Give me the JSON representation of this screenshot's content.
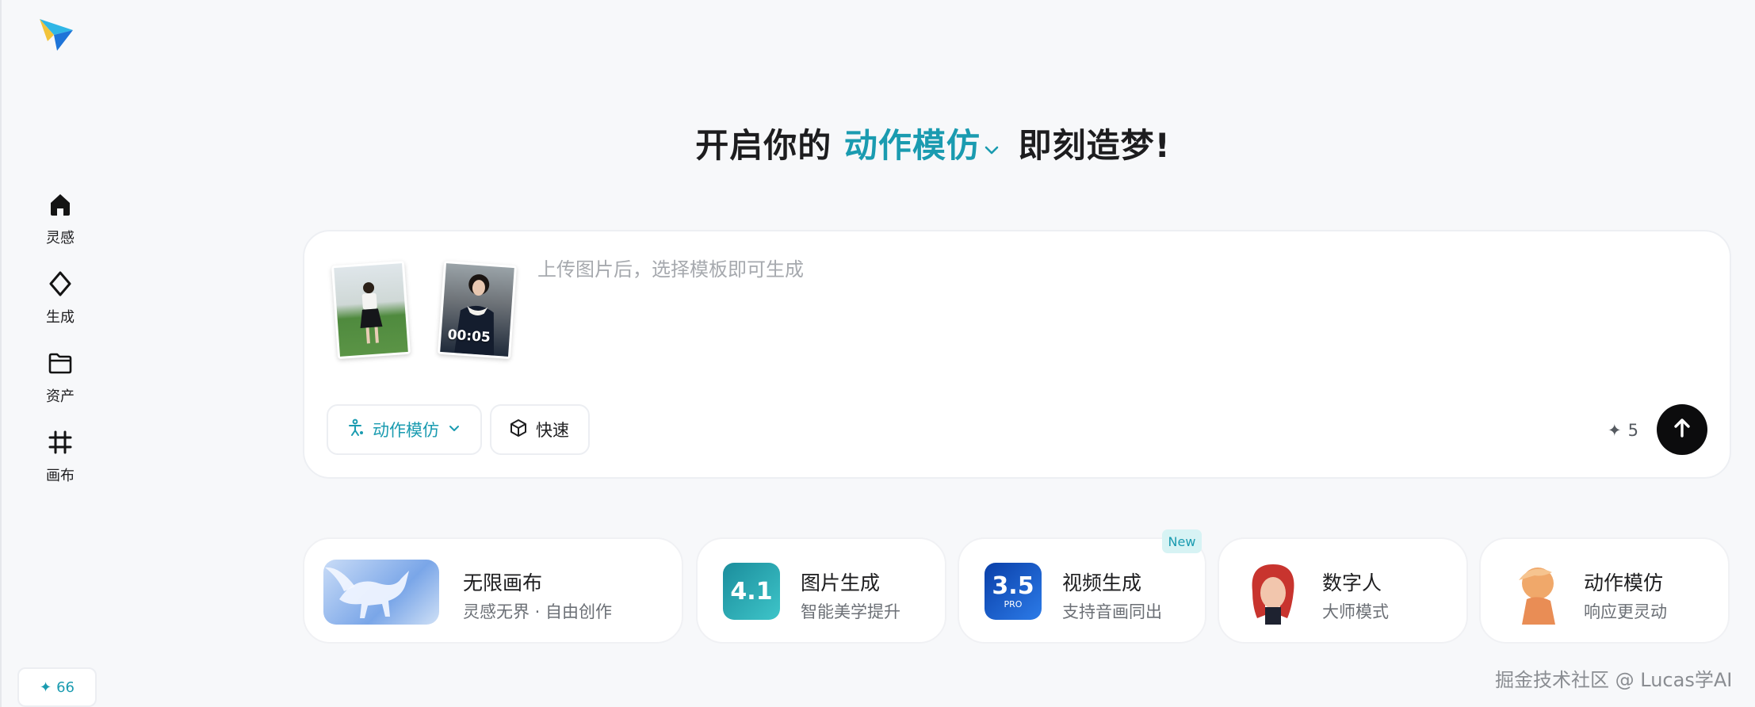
{
  "sidebar": {
    "logo": "paper-plane-logo",
    "items": [
      {
        "label": "灵感",
        "icon": "home-icon"
      },
      {
        "label": "生成",
        "icon": "sparkle-icon"
      },
      {
        "label": "资产",
        "icon": "folder-icon"
      },
      {
        "label": "画布",
        "icon": "canvas-icon"
      }
    ],
    "credits": "66"
  },
  "headline": {
    "prefix": "开启你的",
    "mode": "动作模仿",
    "suffix": "即刻造梦!"
  },
  "composer": {
    "video_time": "00:05",
    "placeholder": "上传图片后，选择模板即可生成",
    "mode_chip": "动作模仿",
    "speed_chip": "快速",
    "cost": "5"
  },
  "cards": [
    {
      "title": "无限画布",
      "subtitle": "灵感无界 · 自由创作"
    },
    {
      "title": "图片生成",
      "subtitle": "智能美学提升",
      "tile": "4.1"
    },
    {
      "title": "视频生成",
      "subtitle": "支持音画同出",
      "tile": "3.5",
      "tile_sub": "PRO",
      "badge": "New"
    },
    {
      "title": "数字人",
      "subtitle": "大师模式"
    },
    {
      "title": "动作模仿",
      "subtitle": "响应更灵动"
    }
  ],
  "watermark": "掘金技术社区 @ Lucas学AI",
  "colors": {
    "accent": "#1a9bb0",
    "background": "#f7f8fa",
    "send_button": "#0c0c0d"
  }
}
